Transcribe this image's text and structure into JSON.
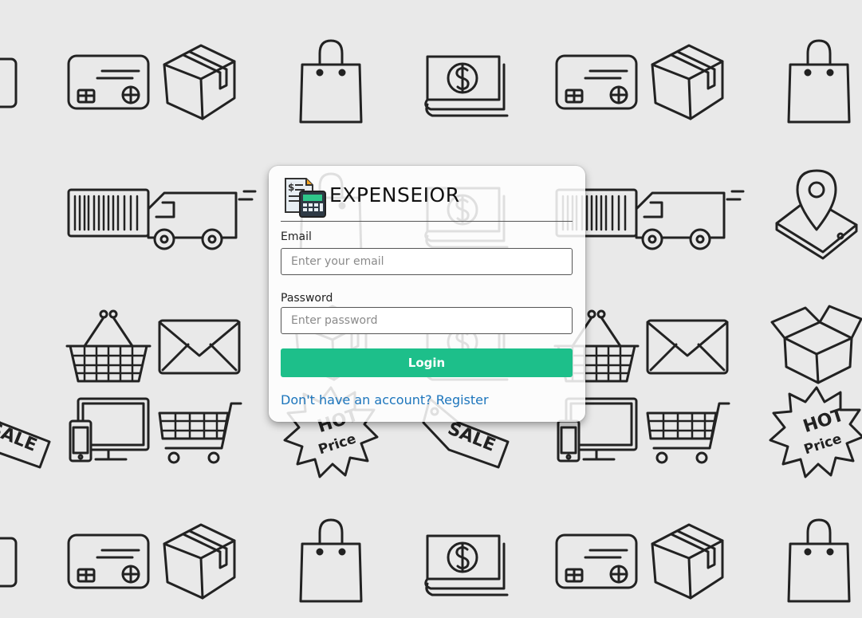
{
  "app": {
    "brand": "EXPENSEIOR",
    "accent_color": "#1dbf8a",
    "link_color": "#1c75bc"
  },
  "background": {
    "pattern_icons": [
      "credit-card-icon",
      "box-icon",
      "shopping-bag-icon",
      "money-icon",
      "truck-icon",
      "barcode-icon",
      "map-pin-icon",
      "basket-icon",
      "envelope-icon",
      "devices-icon",
      "shopping-cart-icon",
      "hot-price-tag-icon",
      "sale-tag-icon",
      "open-box-icon"
    ]
  },
  "login_form": {
    "email_label": "Email",
    "email_placeholder": "Enter your email",
    "email_value": "",
    "password_label": "Password",
    "password_placeholder": "Enter password",
    "password_value": "",
    "login_button": "Login",
    "register_link": "Don't have an account? Register"
  }
}
